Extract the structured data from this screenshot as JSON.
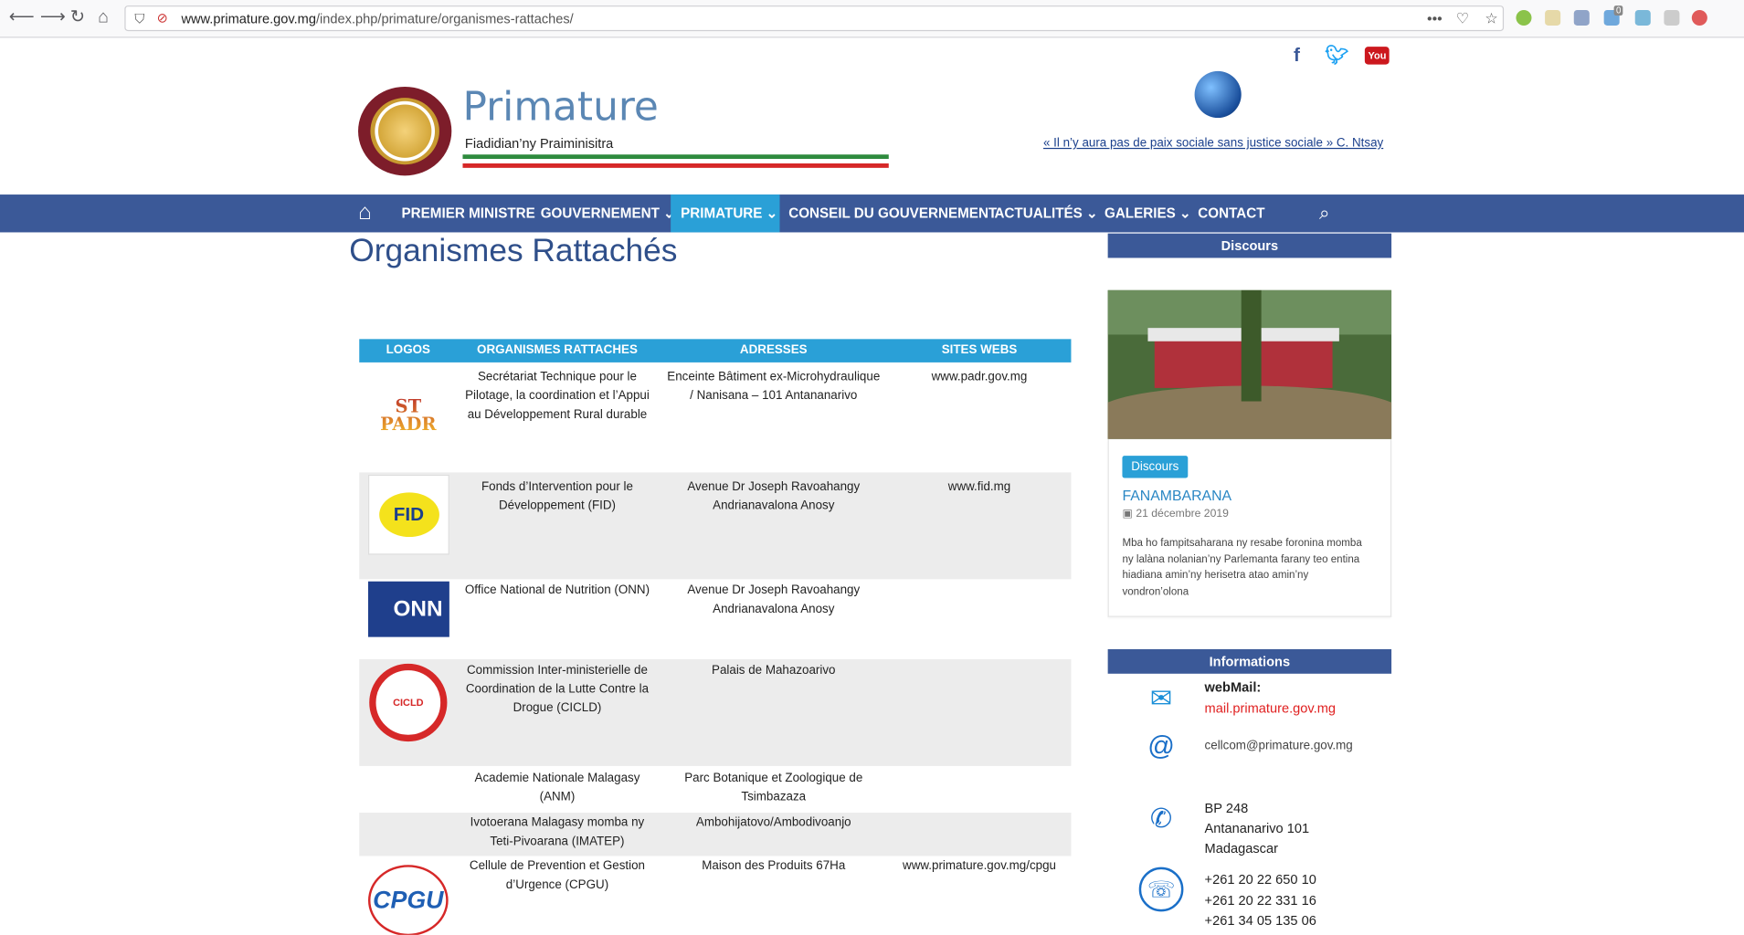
{
  "browser": {
    "url_host": "www.primature.gov.mg",
    "url_path": "/index.php/primature/organismes-rattaches/",
    "more_label": "•••",
    "badge_count": "0"
  },
  "site": {
    "title": "Primature",
    "subtitle": "Fiadidian’ny Praiminisitra",
    "quote": "« Il n’y aura pas de paix sociale sans justice sociale » C. Ntsay",
    "flag_colors": [
      "#2e8b3e",
      "#ffffff",
      "#d62828"
    ]
  },
  "nav": {
    "items": [
      {
        "label": "PREMIER MINISTRE"
      },
      {
        "label": "GOUVERNEMENT ⌄"
      },
      {
        "label": "PRIMATURE ⌄"
      },
      {
        "label": "CONSEIL DU GOUVERNEMENT"
      },
      {
        "label": "ACTUALITÉS ⌄"
      },
      {
        "label": "GALERIES ⌄"
      },
      {
        "label": "CONTACT"
      }
    ],
    "active_index": 2
  },
  "page": {
    "title": "Organismes Rattachés"
  },
  "table": {
    "headers": [
      "LOGOS",
      "ORGANISMES RATTACHES",
      "ADRESSES",
      "SITES WEBS"
    ],
    "rows": [
      {
        "logo": "ST PADR",
        "org": "Secrétariat Technique pour le Pilotage, la coordination et l’Appui au Développement Rural durable",
        "addr": "Enceinte Bâtiment ex-Microhydraulique / Nanisana – 101 Antananarivo",
        "site": "www.padr.gov.mg"
      },
      {
        "logo": "FID",
        "org": "Fonds d’Intervention pour le Développement (FID)",
        "addr": "Avenue Dr Joseph Ravoahangy Andrianavalona Anosy",
        "site": "www.fid.mg"
      },
      {
        "logo": "ONN",
        "org": "Office National de Nutrition (ONN)",
        "addr": "Avenue Dr Joseph Ravoahangy Andrianavalona Anosy",
        "site": ""
      },
      {
        "logo": "CICLD",
        "org": "Commission Inter-ministerielle de Coordination de la Lutte Contre la Drogue (CICLD)",
        "addr": "Palais de Mahazoarivo",
        "site": ""
      },
      {
        "logo": "",
        "org": "Academie Nationale Malagasy (ANM)",
        "addr": "Parc Botanique et Zoologique de Tsimbazaza",
        "site": ""
      },
      {
        "logo": "",
        "org": "Ivotoerana Malagasy momba ny Teti-Pivoarana (IMATEP)",
        "addr": "Ambohijatovo/Ambodivoanjo",
        "site": ""
      },
      {
        "logo": "CPGU",
        "org": "Cellule de Prevention et Gestion d’Urgence (CPGU)",
        "addr": "Maison des Produits 67Ha",
        "site": "www.primature.gov.mg/cpgu"
      }
    ]
  },
  "sidebar": {
    "discours_heading": "Discours",
    "badge": "Discours",
    "post_title": "FANAMBARANA",
    "post_date": "21 décembre 2019",
    "post_excerpt": "Mba ho fampitsaharana ny resabe foronina momba ny lalàna nolanian’ny Parlemanta farany teo entina hiadiana amin’ny herisetra atao amin’ny vondron’olona",
    "info_heading": "Informations",
    "webmail_label": "webMail:",
    "webmail_link": "mail.primature.gov.mg",
    "email": "cellcom@primature.gov.mg",
    "address_lines": [
      "BP 248",
      "Antananarivo 101",
      "Madagascar"
    ],
    "phones": [
      "+261 20 22 650 10",
      "+261 20 22 331 16",
      "+261 34 05 135 06"
    ]
  }
}
